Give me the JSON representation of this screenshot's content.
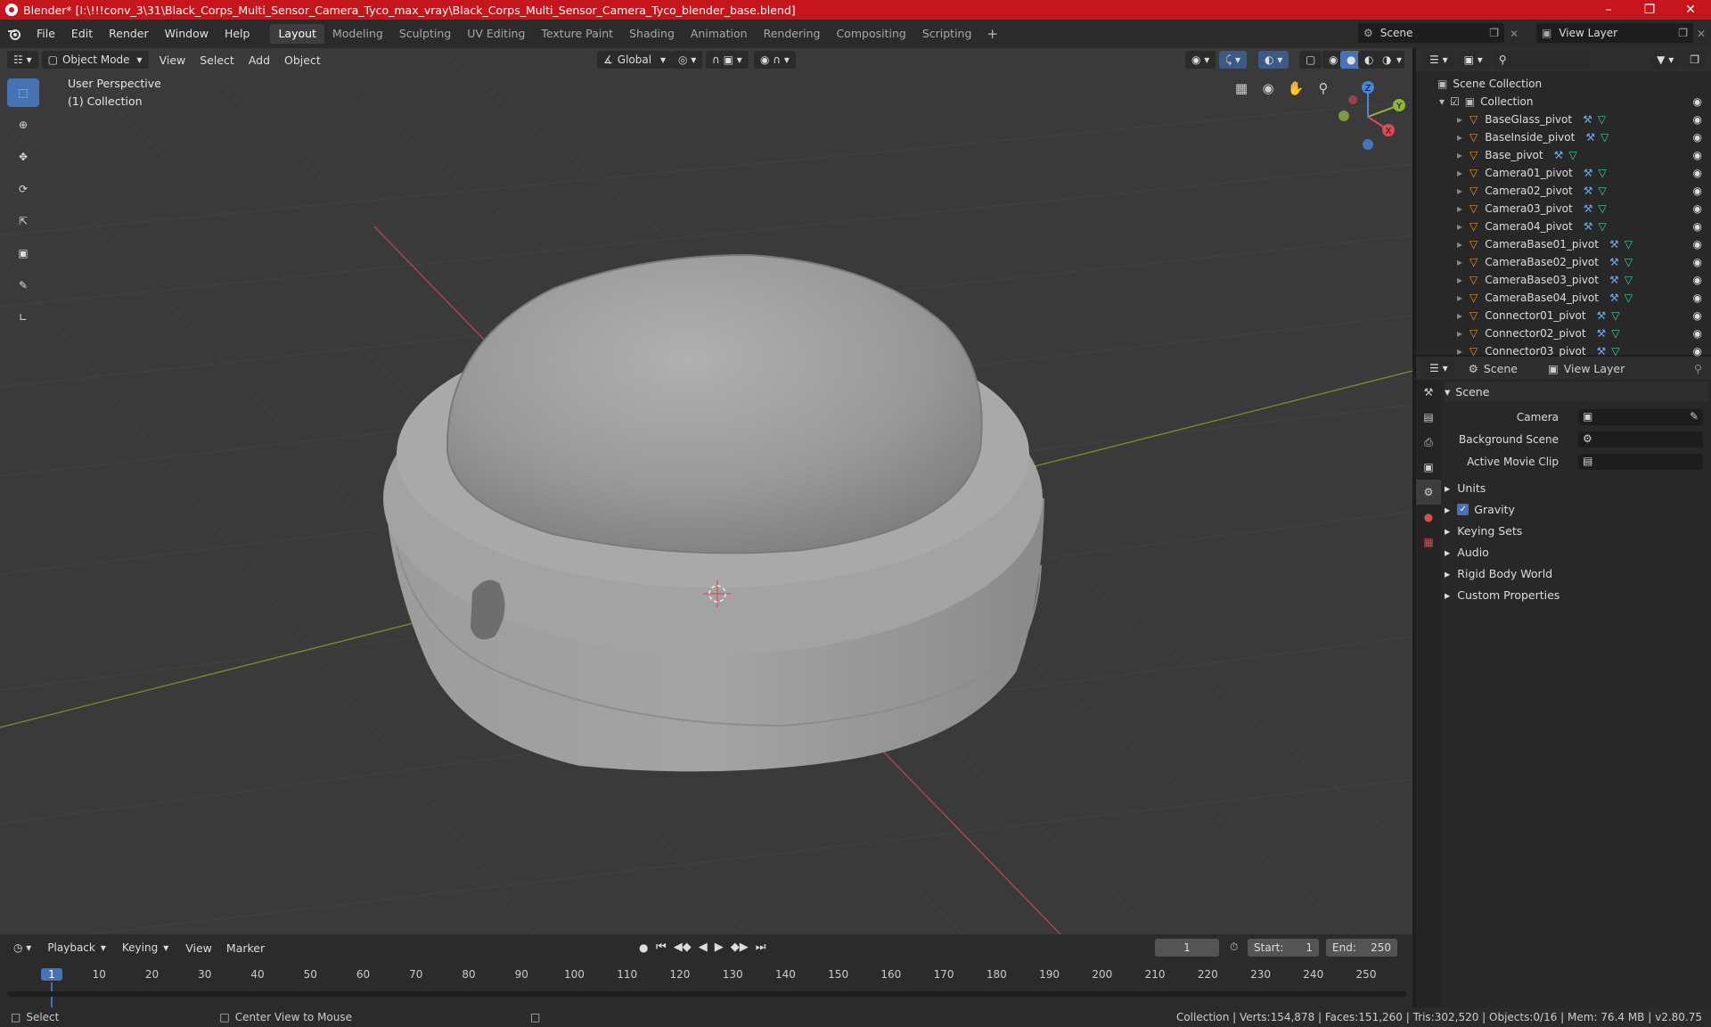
{
  "title": "Blender* [I:\\!!!conv_3\\31\\Black_Corps_Multi_Sensor_Camera_Tyco_max_vray\\Black_Corps_Multi_Sensor_Camera_Tyco_blender_base.blend]",
  "menu": [
    "File",
    "Edit",
    "Render",
    "Window",
    "Help"
  ],
  "workspaces": [
    "Layout",
    "Modeling",
    "Sculpting",
    "UV Editing",
    "Texture Paint",
    "Shading",
    "Animation",
    "Rendering",
    "Compositing",
    "Scripting"
  ],
  "scene_name": "Scene",
  "view_layer_name": "View Layer",
  "viewport": {
    "mode": "Object Mode",
    "menus": [
      "View",
      "Select",
      "Add",
      "Object"
    ],
    "transform_orientation": "Global",
    "perspective_label": "User Perspective",
    "collection_label": "(1) Collection"
  },
  "gizmo": {
    "x": "X",
    "y": "Y",
    "z": "Z"
  },
  "outliner": {
    "root": "Scene Collection",
    "collection": "Collection",
    "items": [
      "BaseGlass_pivot",
      "BaseInside_pivot",
      "Base_pivot",
      "Camera01_pivot",
      "Camera02_pivot",
      "Camera03_pivot",
      "Camera04_pivot",
      "CameraBase01_pivot",
      "CameraBase02_pivot",
      "CameraBase03_pivot",
      "CameraBase04_pivot",
      "Connector01_pivot",
      "Connector02_pivot",
      "Connector03_pivot"
    ]
  },
  "properties": {
    "tab_scene": "Scene",
    "tab_view_layer": "View Layer",
    "section": "Scene",
    "camera_label": "Camera",
    "background_scene_label": "Background Scene",
    "active_movie_clip_label": "Active Movie Clip",
    "subsections": [
      "Units",
      "Gravity",
      "Keying Sets",
      "Audio",
      "Rigid Body World",
      "Custom Properties"
    ],
    "gravity_checked": true
  },
  "timeline": {
    "menus": [
      "Playback",
      "Keying",
      "View",
      "Marker"
    ],
    "current_frame": "1",
    "start_label": "Start:",
    "start": "1",
    "end_label": "End:",
    "end": "250",
    "ticks": [
      "1",
      "10",
      "20",
      "30",
      "40",
      "50",
      "60",
      "70",
      "80",
      "90",
      "100",
      "110",
      "120",
      "130",
      "140",
      "150",
      "160",
      "170",
      "180",
      "190",
      "200",
      "210",
      "220",
      "230",
      "240",
      "250"
    ]
  },
  "status": {
    "select": "Select",
    "center": "Center View to Mouse",
    "stats": "Collection | Verts:154,878 | Faces:151,260 | Tris:302,520 | Objects:0/16 | Mem: 76.4 MB | v2.80.75"
  },
  "colors": {
    "accent": "#4772b3",
    "titlebar": "#c4161c",
    "x_axis": "#e04858",
    "y_axis": "#8fb33b",
    "z_axis": "#4a86d8"
  }
}
